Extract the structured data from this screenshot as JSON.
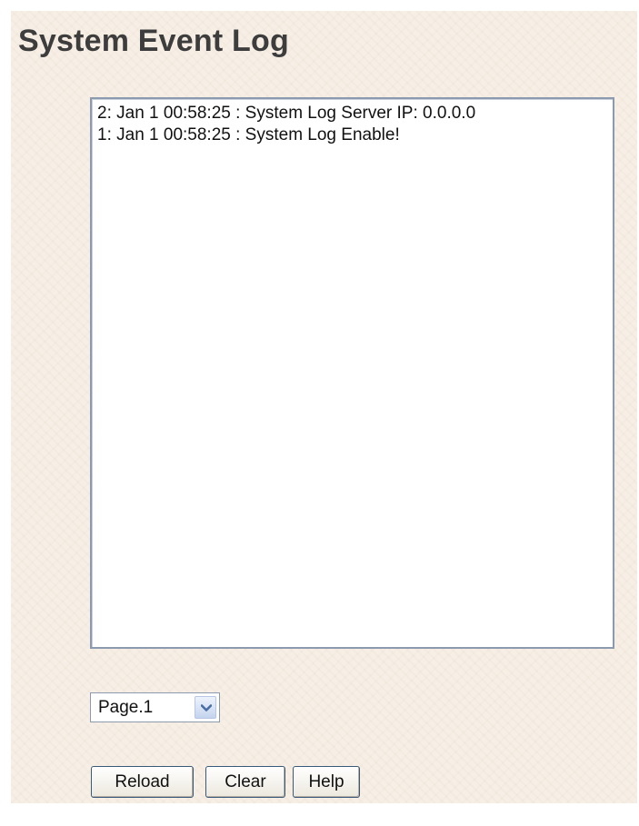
{
  "header": {
    "title": "System Event Log"
  },
  "log": {
    "entries": [
      "2: Jan 1 00:58:25 : System Log Server IP: 0.0.0.0",
      "1: Jan 1 00:58:25 : System Log Enable!"
    ]
  },
  "pagination": {
    "selected": "Page.1",
    "icon": "chevron-down-icon"
  },
  "buttons": {
    "reload": "Reload",
    "clear": "Clear",
    "help": "Help"
  },
  "colors": {
    "background": "#f7efe6",
    "title_text": "#3d3d3d",
    "border": "#8c9ab0",
    "button_border": "#3a5a7c"
  }
}
